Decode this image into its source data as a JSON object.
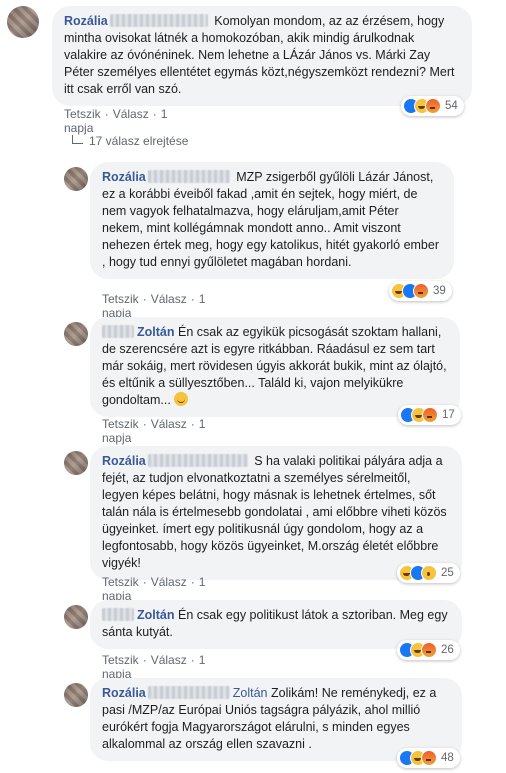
{
  "comments": [
    {
      "author": "Rozália",
      "text": "Komolyan mondom, az az érzésem, hogy mintha ovisokat látnék a homokozóban, akik mindig árulkodnak valakire az óvónéninek. Nem lehetne a LÁzár János vs. Márki Zay Péter személyes ellentétet egymás közt,négyszemközt rendezni? Mert itt csak erről van szó.",
      "like": "Tetszik",
      "reply": "Válasz",
      "time": "1 napja",
      "reaction_count": "54",
      "reactions": [
        "like-icon",
        "haha-icon",
        "angry-icon"
      ]
    },
    {
      "author": "Rozália",
      "text": "MZP zsigerből gyűlöli Lázár Jánost, ez a korábbi éveiből fakad ,amit én sejtek, hogy miért, de nem vagyok felhatalmazva, hogy eláruljam,amit Péter nekem, mint kollégámnak mondott anno.. Amit viszont nehezen értek meg, hogy egy katolikus, hitét gyakorló ember , hogy tud ennyi gyűlöletet magában hordani.",
      "like": "Tetszik",
      "reply": "Válasz",
      "time": "1 napja",
      "reaction_count": "39",
      "reactions": [
        "haha-icon",
        "like-icon",
        "angry-icon"
      ]
    },
    {
      "author": "Zoltán",
      "text": "Én csak az egyikük picsogását szoktam hallani, de szerencsére azt is egyre ritkábban. Ráadásul ez sem tart már sokáig, mert rövidesen úgyis akkorát bukik, mint az ólajtó, és eltűnik a süllyesztőben... Találd ki, vajon melyikükre gondoltam...",
      "like": "Tetszik",
      "reply": "Válasz",
      "time": "1 napja",
      "reaction_count": "17",
      "reactions": [
        "like-icon",
        "haha-icon",
        "angry-icon"
      ]
    },
    {
      "author": "Rozália",
      "text": "S ha valaki politikai pályára adja a fejét, az tudjon elvonatkoztatni a személyes sérelmeitől, legyen képes belátni, hogy másnak is lehetnek értelmes, sőt talán nála is értelmesebb gondolatai , ami előbbre viheti közös ügyeinket. ímert egy politikusnál úgy gondolom, hogy az a legfontosabb, hogy közös ügyeinket, M.ország életét előbbre vigyék!",
      "like": "Tetszik",
      "reply": "Válasz",
      "time": "1 napja",
      "reaction_count": "25",
      "reactions": [
        "haha-icon",
        "like-icon",
        "wow-icon"
      ]
    },
    {
      "author": "Zoltán",
      "text": "Én csak egy politikust látok a sztoriban. Meg egy sánta kutyát.",
      "like": "Tetszik",
      "reply": "Válasz",
      "time": "1 napja",
      "reaction_count": "26",
      "reactions": [
        "like-icon",
        "haha-icon",
        "angry-icon"
      ]
    },
    {
      "author": "Rozália",
      "mention": "Zoltán",
      "text": "Zolikám! Ne reménykedj, ez a pasi /MZP/az Európai Uniós tagságra pályázik, ahol millió eurókért fogja Magyarországot elárulni, s minden egyes alkalommal az ország ellen szavazni .",
      "like": "Tetszik",
      "reply": "Válasz",
      "time": "1 napja",
      "reaction_count": "48",
      "reactions": [
        "like-icon",
        "haha-icon",
        "angry-icon"
      ]
    }
  ],
  "replies_toggle": "17 válasz elrejtése",
  "colors": {
    "author": "#385898",
    "bubble": "#f2f3f5",
    "meta": "#606770"
  }
}
